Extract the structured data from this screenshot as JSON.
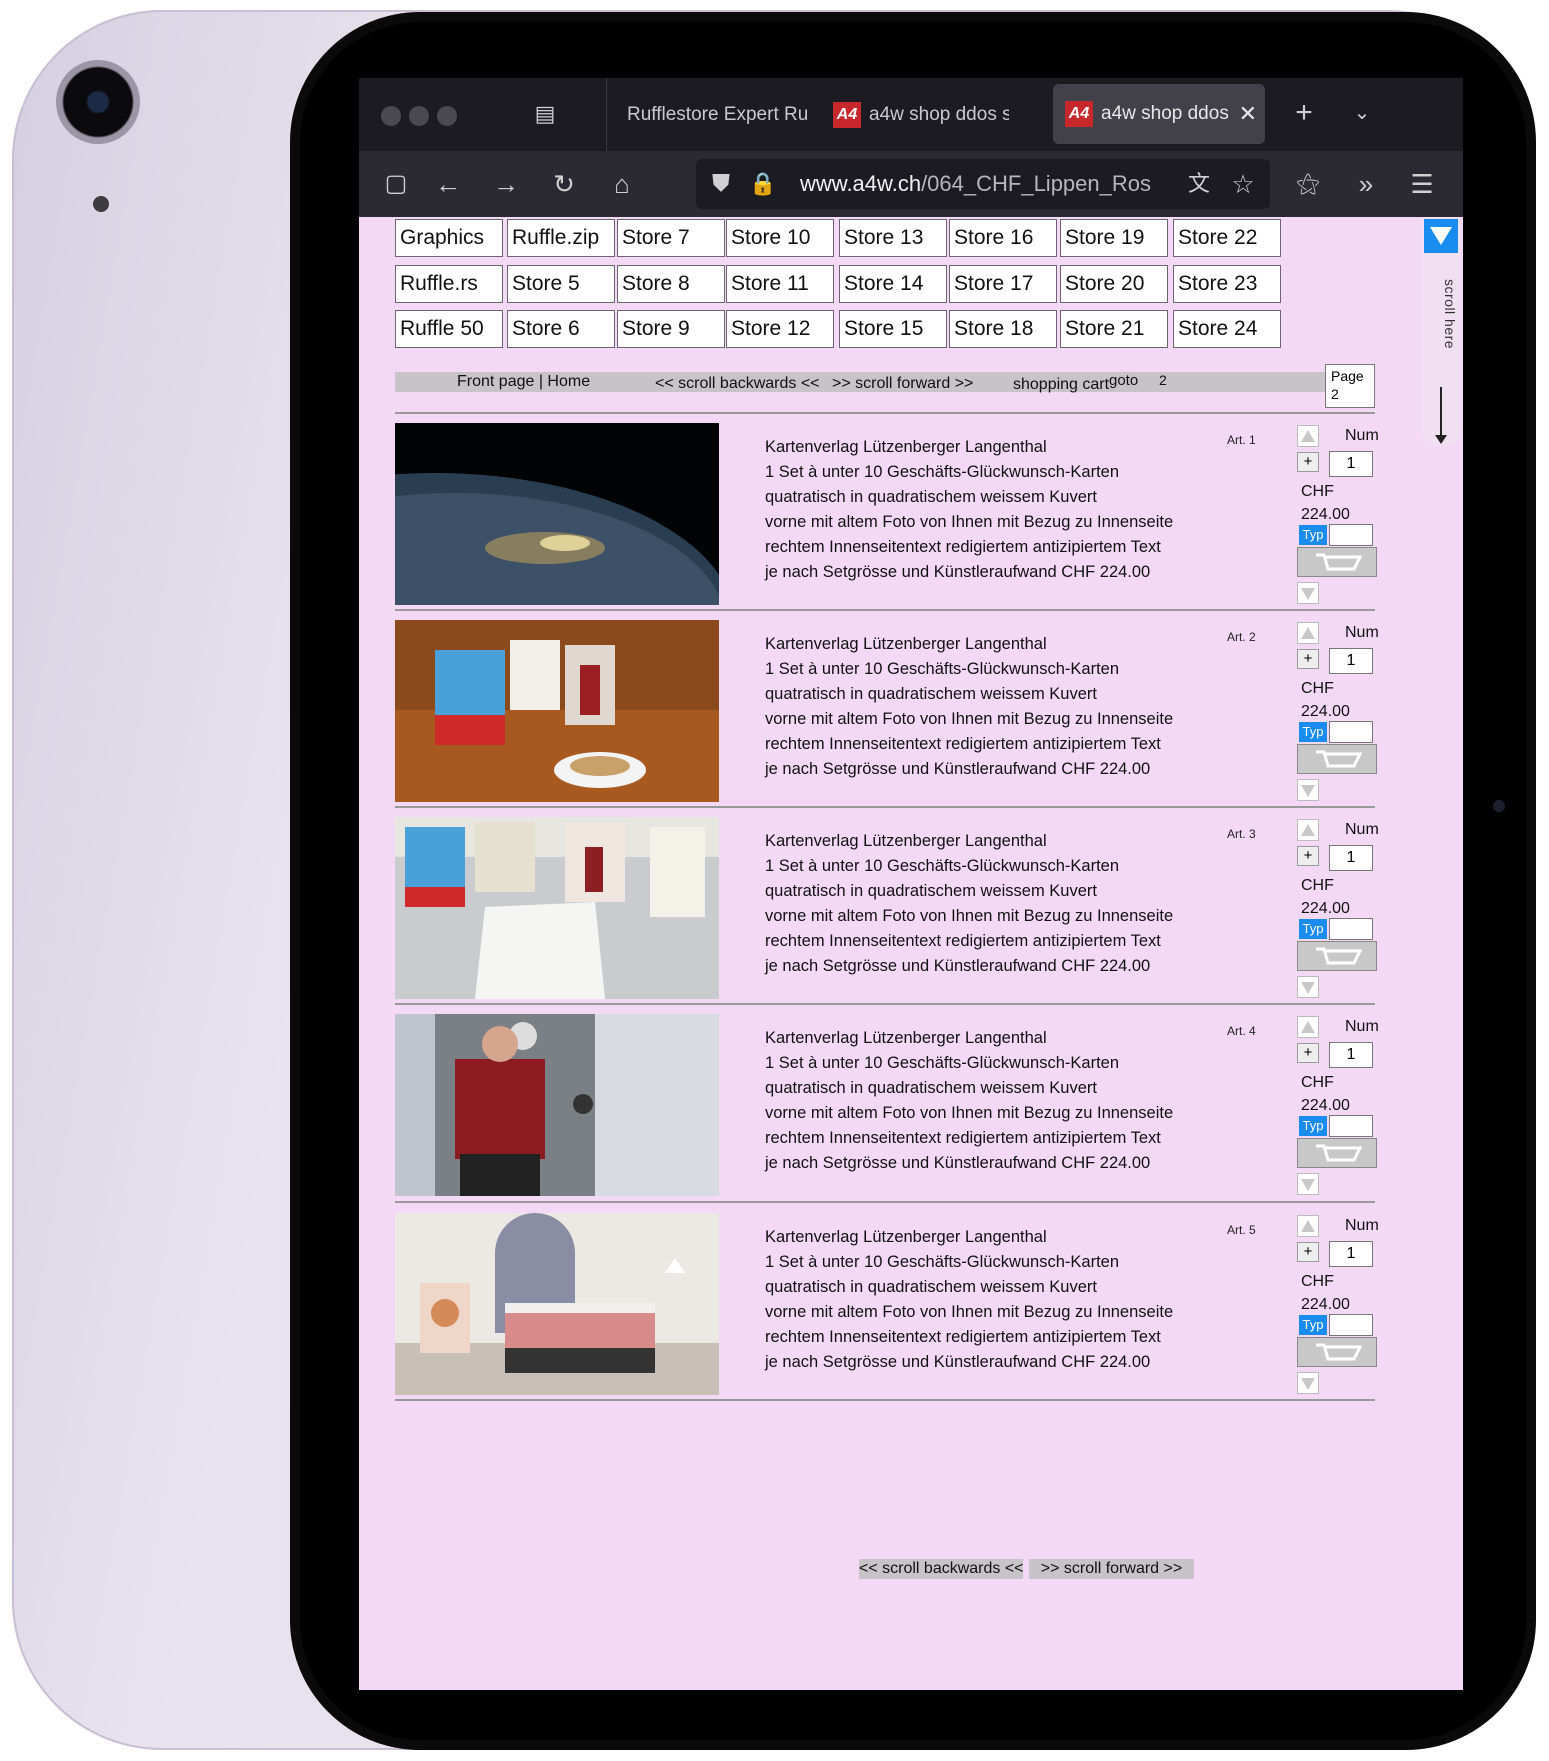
{
  "browser": {
    "tabs": [
      {
        "label": "Rufflestore Expert Ru",
        "favicon": ""
      },
      {
        "label": "a4w shop ddos s",
        "favicon": "A4"
      },
      {
        "label": "a4w shop ddos",
        "favicon": "A4",
        "active": true
      }
    ],
    "url_domain": "www.a4w.ch",
    "url_path": "/064_CHF_Lippen_Ros"
  },
  "stores": [
    "Graphics",
    "Ruffle.zip",
    "Store 7",
    "Store 10",
    "Store 13",
    "Store 16",
    "Store 19",
    "Store 22",
    "Ruffle.rs",
    "Store 5",
    "Store 8",
    "Store 11",
    "Store 14",
    "Store 17",
    "Store 20",
    "Store 23",
    "Ruffle 50",
    "Store 6",
    "Store 9",
    "Store 12",
    "Store 15",
    "Store 18",
    "Store 21",
    "Store 24"
  ],
  "nav": {
    "front": "Front page | Home",
    "back": "<< scroll backwards <<",
    "forward": ">> scroll forward >>",
    "cart": "shopping cart",
    "goto": "goto",
    "goto_num": "2",
    "page_label": "Page",
    "page_num": "2"
  },
  "scroll_hint": "scroll here",
  "products": [
    {
      "art": "Art. 1",
      "num_label": "Num",
      "qty": "1",
      "currency": "CHF",
      "price": "224.00",
      "typ": "Typ",
      "lines": [
        "Kartenverlag Lützenberger Langenthal",
        "1 Set à unter 10 Geschäfts-Glückwunsch-Karten",
        "quatratisch in quadratischem weissem Kuvert",
        "vorne mit altem Foto von Ihnen mit Bezug zu Innenseite",
        "rechtem Innenseitentext redigiertem antizipiertem Text",
        "je nach Setgrösse und Künstleraufwand CHF 224.00"
      ]
    },
    {
      "art": "Art. 2",
      "num_label": "Num",
      "qty": "1",
      "currency": "CHF",
      "price": "224.00",
      "typ": "Typ",
      "lines": [
        "Kartenverlag Lützenberger Langenthal",
        "1 Set à unter 10 Geschäfts-Glückwunsch-Karten",
        "quatratisch in quadratischem weissem Kuvert",
        "vorne mit altem Foto von Ihnen mit Bezug zu Innenseite",
        "rechtem Innenseitentext redigiertem antizipiertem Text",
        "je nach Setgrösse und Künstleraufwand CHF 224.00"
      ]
    },
    {
      "art": "Art. 3",
      "num_label": "Num",
      "qty": "1",
      "currency": "CHF",
      "price": "224.00",
      "typ": "Typ",
      "lines": [
        "Kartenverlag Lützenberger Langenthal",
        "1 Set à unter 10 Geschäfts-Glückwunsch-Karten",
        "quatratisch in quadratischem weissem Kuvert",
        "vorne mit altem Foto von Ihnen mit Bezug zu Innenseite",
        "rechtem Innenseitentext redigiertem antizipiertem Text",
        "je nach Setgrösse und Künstleraufwand CHF 224.00"
      ]
    },
    {
      "art": "Art. 4",
      "num_label": "Num",
      "qty": "1",
      "currency": "CHF",
      "price": "224.00",
      "typ": "Typ",
      "lines": [
        "Kartenverlag Lützenberger Langenthal",
        "1 Set à unter 10 Geschäfts-Glückwunsch-Karten",
        "quatratisch in quadratischem weissem Kuvert",
        "vorne mit altem Foto von Ihnen mit Bezug zu Innenseite",
        "rechtem Innenseitentext redigiertem antizipiertem Text",
        "je nach Setgrösse und Künstleraufwand CHF 224.00"
      ]
    },
    {
      "art": "Art. 5",
      "num_label": "Num",
      "qty": "1",
      "currency": "CHF",
      "price": "224.00",
      "typ": "Typ",
      "lines": [
        "Kartenverlag Lützenberger Langenthal",
        "1 Set à unter 10 Geschäfts-Glückwunsch-Karten",
        "quatratisch in quadratischem weissem Kuvert",
        "vorne mit altem Foto von Ihnen mit Bezug zu Innenseite",
        "rechtem Innenseitentext redigiertem antizipiertem Text",
        "je nach Setgrösse und Künstleraufwand CHF 224.00"
      ]
    }
  ],
  "bottom_nav": {
    "back": "<< scroll backwards <<",
    "forward": ">> scroll forward >>"
  },
  "colors": {
    "page_bg": "#f4d9f6",
    "accent": "#1a8cf0",
    "browser_chrome": "#2b2a33"
  }
}
